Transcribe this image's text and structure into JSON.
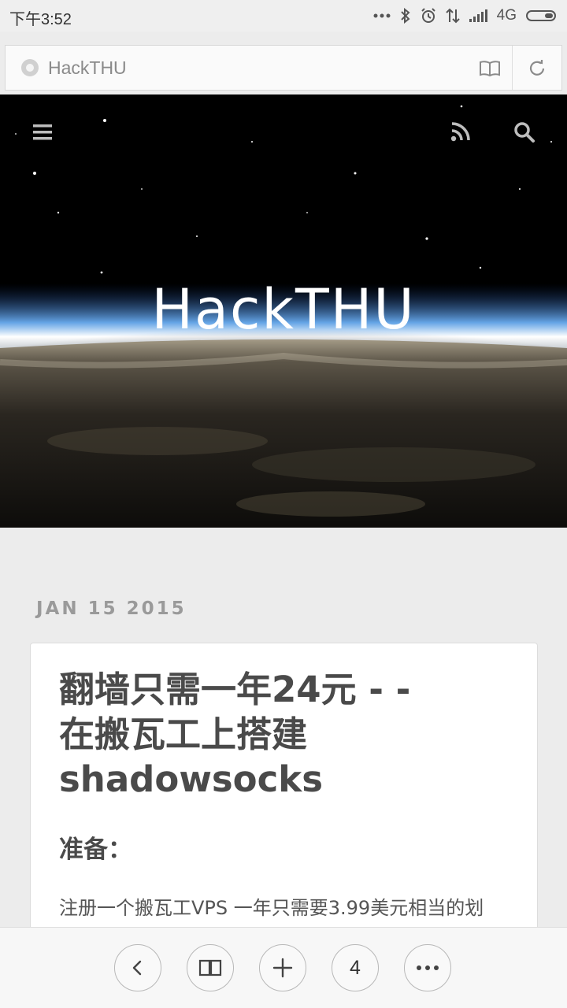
{
  "status_bar": {
    "time": "下午3:52",
    "network": "4G"
  },
  "address_bar": {
    "title": "HackTHU",
    "icons": [
      "site-favicon",
      "reader-mode-icon",
      "refresh-icon"
    ]
  },
  "hero": {
    "title": "HackTHU",
    "icons": [
      "menu-icon",
      "rss-icon",
      "search-icon"
    ]
  },
  "post": {
    "date": "JAN 15 2015",
    "title_lines": [
      "翻墙只需一年24元 - -",
      "在搬瓦工上搭建",
      "shadowsocks"
    ],
    "section_heading": "准备：",
    "body_text": "注册一个搬瓦工VPS 一年只需要3.99美元相当的划"
  },
  "toolbar": {
    "tab_count": "4",
    "icons": [
      "back-icon",
      "bookmarks-icon",
      "new-tab-icon",
      "tabs-counter",
      "more-icon"
    ]
  },
  "colors": {
    "status_bg": "#efefef",
    "page_bg": "#ececec",
    "card_bg": "#ffffff",
    "title_text": "#4a4a4a",
    "date_text": "#9a9a9a",
    "hero_text": "#ffffff"
  }
}
